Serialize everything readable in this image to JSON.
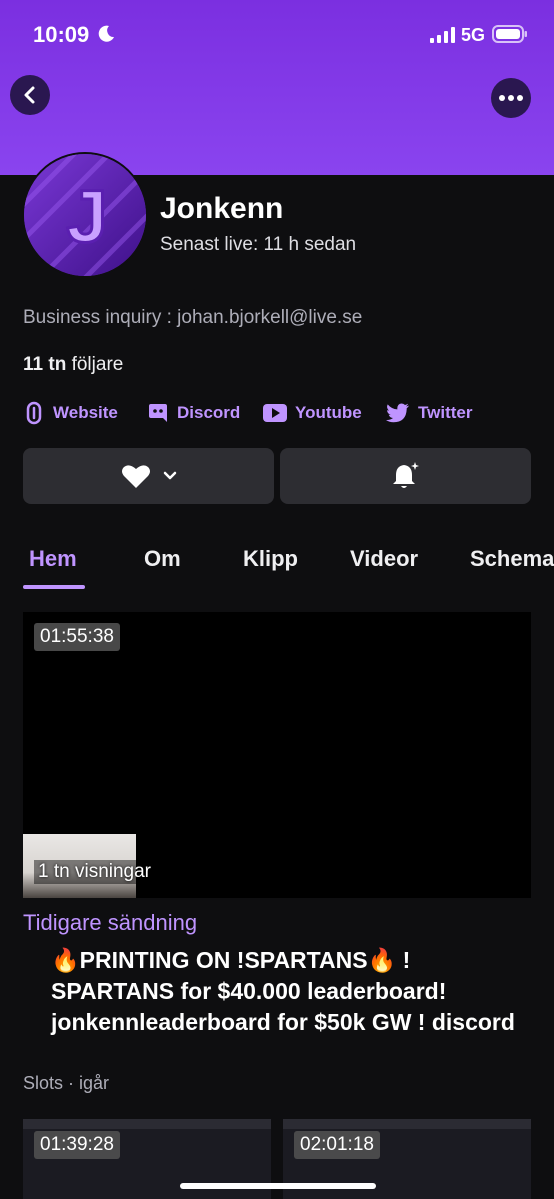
{
  "status_bar": {
    "time": "10:09",
    "network": "5G"
  },
  "channel": {
    "name": "Jonkenn",
    "avatar_letter": "J",
    "last_live": "Senast live: 11 h sedan",
    "bio": "Business inquiry : johan.bjorkell@live.se",
    "followers_count": "11 tn",
    "followers_label": " följare"
  },
  "links": [
    {
      "label": "Website",
      "icon": "link-icon"
    },
    {
      "label": "Discord",
      "icon": "discord-icon"
    },
    {
      "label": "Youtube",
      "icon": "youtube-icon"
    },
    {
      "label": "Twitter",
      "icon": "twitter-icon"
    }
  ],
  "tabs": [
    "Hem",
    "Om",
    "Klipp",
    "Videor",
    "Schema"
  ],
  "featured_video": {
    "duration": "01:55:38",
    "views": "1 tn visningar",
    "type_label": "Tidigare sändning",
    "title": "🔥PRINTING ON !SPARTANS🔥 ! SPARTANS for $40.000 leaderboard! jonkennleaderboard for $50k GW ! discord",
    "meta": "Slots · igår"
  },
  "more_videos": [
    {
      "duration": "01:39:28"
    },
    {
      "duration": "02:01:18"
    }
  ],
  "colors": {
    "accent": "#bf94ff",
    "header": "#8a44ef",
    "background": "#0e0e10",
    "button": "#2d2d32"
  }
}
